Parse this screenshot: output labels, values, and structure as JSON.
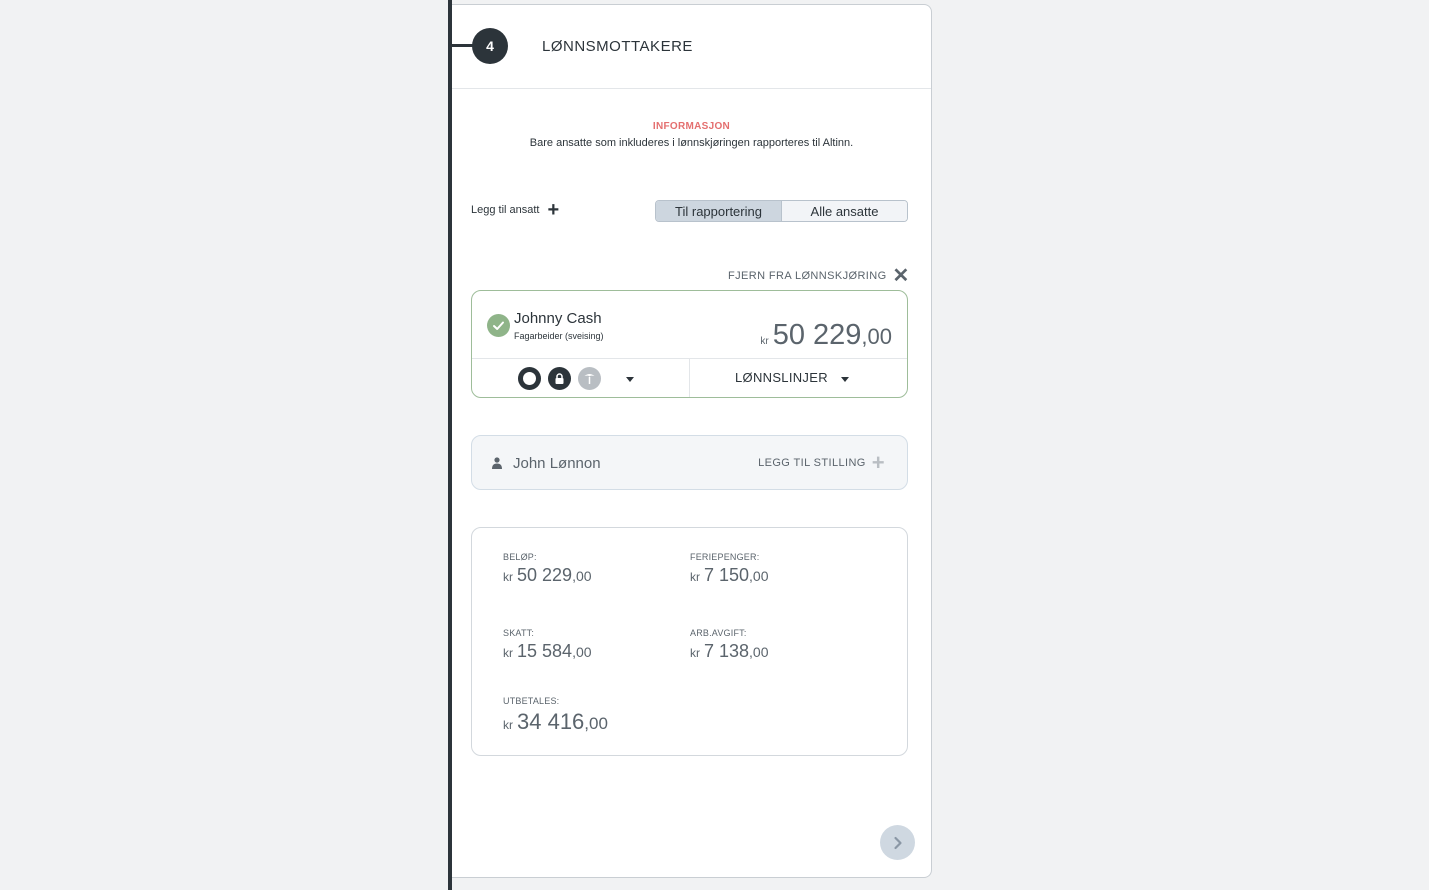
{
  "step": {
    "number": "4",
    "title": "LØNNSMOTTAKERE"
  },
  "info": {
    "label": "INFORMASJON",
    "text": "Bare ansatte som inkluderes i lønnskjøringen rapporteres til Altinn."
  },
  "toolbar": {
    "add_employee": "Legg til ansatt",
    "toggle_reporting": "Til rapportering",
    "toggle_all": "Alle ansatte"
  },
  "remove_label": "FJERN FRA LØNNSKJØRING",
  "employee1": {
    "name": "Johnny Cash",
    "role": "Fagarbeider (sveising)",
    "currency": "kr",
    "amount_int": "50 229",
    "amount_dec": ",00",
    "lines_label": "LØNNSLINJER"
  },
  "employee2": {
    "name": "John Lønnon",
    "add_position": "LEGG TIL STILLING"
  },
  "summary": {
    "belop": {
      "label": "BELØP:",
      "currency": "kr",
      "int": "50 229",
      "dec": ",00"
    },
    "feriepenger": {
      "label": "FERIEPENGER:",
      "currency": "kr",
      "int": "7 150",
      "dec": ",00"
    },
    "skatt": {
      "label": "SKATT:",
      "currency": "kr",
      "int": "15 584",
      "dec": ",00"
    },
    "arbavgift": {
      "label": "ARB.AVGIFT:",
      "currency": "kr",
      "int": "7 138",
      "dec": ",00"
    },
    "utbetales": {
      "label": "UTBETALES:",
      "currency": "kr",
      "int": "34 416",
      "dec": ",00"
    }
  },
  "colors": {
    "accent_dark": "#2c343a",
    "info_red": "#e46f6f",
    "success_green": "#8fb489",
    "muted": "#5b646c"
  },
  "icons": [
    "check-icon",
    "circle-icon",
    "lock-icon",
    "palm-tree-icon",
    "chevron-down-icon",
    "person-icon",
    "plus-icon",
    "close-icon",
    "chevron-right-icon"
  ]
}
